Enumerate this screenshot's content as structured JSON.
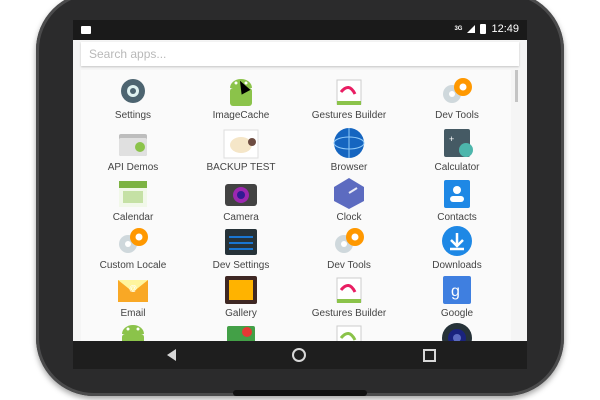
{
  "status_bar": {
    "time": "12:49",
    "signal": "3G"
  },
  "search": {
    "placeholder": "Search apps..."
  },
  "apps": [
    {
      "label": "Settings",
      "icon": "settings-gear-icon",
      "color": "#4d6470"
    },
    {
      "label": "ImageCache",
      "icon": "android-icon",
      "color": "#8bc34a"
    },
    {
      "label": "Gestures Builder",
      "icon": "gestures-icon",
      "color": "#e91e63"
    },
    {
      "label": "Dev Tools",
      "icon": "dev-tools-gears-icon",
      "color": "#ff9800"
    },
    {
      "label": "API Demos",
      "icon": "folder-gear-icon",
      "color": "#9e9e9e"
    },
    {
      "label": "BACKUP TEST",
      "icon": "sheep-icon",
      "color": "#c8a06a"
    },
    {
      "label": "Browser",
      "icon": "globe-icon",
      "color": "#1565c0"
    },
    {
      "label": "Calculator",
      "icon": "calculator-icon",
      "color": "#455a64"
    },
    {
      "label": "Calendar",
      "icon": "calendar-icon",
      "color": "#7cb342"
    },
    {
      "label": "Camera",
      "icon": "camera-icon",
      "color": "#424242"
    },
    {
      "label": "Clock",
      "icon": "clock-icon",
      "color": "#5c6bc0"
    },
    {
      "label": "Contacts",
      "icon": "contacts-icon",
      "color": "#1e88e5"
    },
    {
      "label": "Custom Locale",
      "icon": "custom-locale-gears-icon",
      "color": "#ff9800"
    },
    {
      "label": "Dev Settings",
      "icon": "dev-settings-icon",
      "color": "#1976d2"
    },
    {
      "label": "Dev Tools",
      "icon": "dev-tools-gears-icon",
      "color": "#ff9800"
    },
    {
      "label": "Downloads",
      "icon": "download-icon",
      "color": "#1e88e5"
    },
    {
      "label": "Email",
      "icon": "email-envelope-icon",
      "color": "#f9a825"
    },
    {
      "label": "Gallery",
      "icon": "gallery-icon",
      "color": "#ffb300"
    },
    {
      "label": "Gestures Builder",
      "icon": "gestures-icon",
      "color": "#e91e63"
    },
    {
      "label": "Google",
      "icon": "google-icon",
      "color": "#3f7fe0"
    },
    {
      "label": "",
      "icon": "android-icon",
      "color": "#8bc34a"
    },
    {
      "label": "",
      "icon": "maps-icon",
      "color": "#43a047"
    },
    {
      "label": "",
      "icon": "gestures-icon",
      "color": "#8bc34a"
    },
    {
      "label": "",
      "icon": "speaker-icon",
      "color": "#1a237e"
    }
  ]
}
